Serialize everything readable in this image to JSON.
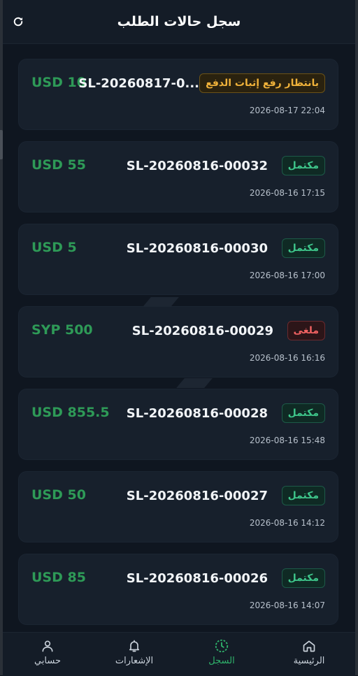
{
  "header": {
    "title": "سجل حالات الطلب",
    "refresh_icon": "refresh-icon"
  },
  "colors": {
    "background": "#0f1620",
    "card": "#17202c",
    "amount": "#2e9a57",
    "status_done": "#3ec58a",
    "status_pending": "#f0b23a",
    "status_cancelled": "#f06262",
    "nav_active": "#2fb36b"
  },
  "orders": [
    {
      "status": "بانتظار رفع إثبات الدفع",
      "status_type": "pending",
      "id": "SL-20260817-0...",
      "amount": "USD 10",
      "time": "2026-08-17 22:04"
    },
    {
      "status": "مكتمل",
      "status_type": "done",
      "id": "SL-20260816-00032",
      "amount": "USD 55",
      "time": "2026-08-16 17:15"
    },
    {
      "status": "مكتمل",
      "status_type": "done",
      "id": "SL-20260816-00030",
      "amount": "USD 5",
      "time": "2026-08-16 17:00"
    },
    {
      "status": "ملغى",
      "status_type": "cancel",
      "id": "SL-20260816-00029",
      "amount": "SYP 500",
      "time": "2026-08-16 16:16"
    },
    {
      "status": "مكتمل",
      "status_type": "done",
      "id": "SL-20260816-00028",
      "amount": "USD 855.5",
      "time": "2026-08-16 15:48"
    },
    {
      "status": "مكتمل",
      "status_type": "done",
      "id": "SL-20260816-00027",
      "amount": "USD 50",
      "time": "2026-08-16 14:12"
    },
    {
      "status": "مكتمل",
      "status_type": "done",
      "id": "SL-20260816-00026",
      "amount": "USD 85",
      "time": "2026-08-16 14:07"
    }
  ],
  "nav": {
    "home": {
      "label": "الرئيسية",
      "icon": "home-icon"
    },
    "history": {
      "label": "السجل",
      "icon": "clock-icon",
      "active": true
    },
    "notifications": {
      "label": "الإشعارات",
      "icon": "bell-icon"
    },
    "account": {
      "label": "حسابي",
      "icon": "user-icon"
    }
  }
}
